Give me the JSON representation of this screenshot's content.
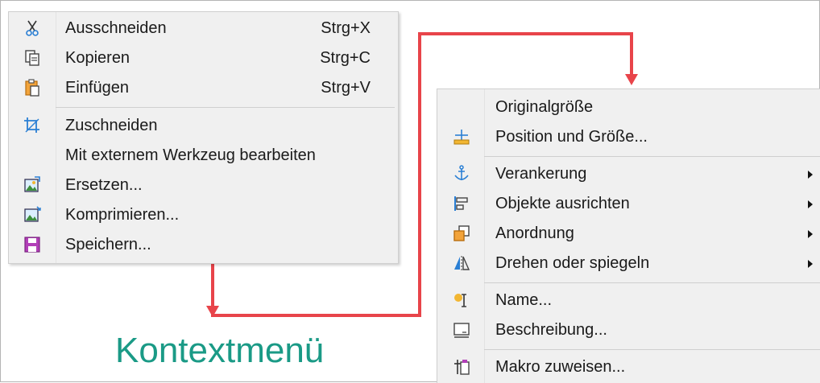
{
  "left_menu": {
    "items": [
      {
        "label": "Ausschneiden",
        "shortcut": "Strg+X",
        "icon": "scissors-icon"
      },
      {
        "label": "Kopieren",
        "shortcut": "Strg+C",
        "icon": "copy-icon"
      },
      {
        "label": "Einfügen",
        "shortcut": "Strg+V",
        "icon": "paste-icon"
      },
      {
        "label": "Zuschneiden",
        "shortcut": "",
        "icon": "crop-icon"
      },
      {
        "label": "Mit externem Werkzeug bearbeiten",
        "shortcut": "",
        "icon": ""
      },
      {
        "label": "Ersetzen...",
        "shortcut": "",
        "icon": "replace-image-icon"
      },
      {
        "label": "Komprimieren...",
        "shortcut": "",
        "icon": "compress-image-icon"
      },
      {
        "label": "Speichern...",
        "shortcut": "",
        "icon": "save-icon"
      }
    ]
  },
  "right_menu": {
    "items": [
      {
        "label": "Originalgröße",
        "icon": "",
        "submenu": false
      },
      {
        "label": "Position und Größe...",
        "icon": "position-size-icon",
        "submenu": false
      },
      {
        "label": "Verankerung",
        "icon": "anchor-icon",
        "submenu": true
      },
      {
        "label": "Objekte ausrichten",
        "icon": "align-objects-icon",
        "submenu": true
      },
      {
        "label": "Anordnung",
        "icon": "arrange-icon",
        "submenu": true
      },
      {
        "label": "Drehen oder spiegeln",
        "icon": "rotate-flip-icon",
        "submenu": true
      },
      {
        "label": "Name...",
        "icon": "name-icon",
        "submenu": false
      },
      {
        "label": "Beschreibung...",
        "icon": "description-icon",
        "submenu": false
      },
      {
        "label": "Makro zuweisen...",
        "icon": "assign-macro-icon",
        "submenu": false
      }
    ]
  },
  "caption": "Kontextmenü",
  "colors": {
    "connector": "#e8444a",
    "caption": "#1a9a86",
    "menu_bg": "#f0f0f0"
  }
}
